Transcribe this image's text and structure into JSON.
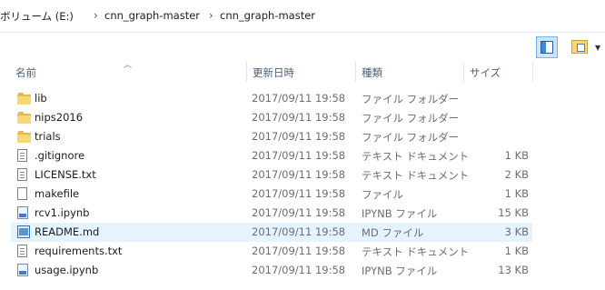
{
  "breadcrumb": {
    "drive": "ボリューム (E:)",
    "folder1": "cnn_graph-master",
    "folder2": "cnn_graph-master"
  },
  "columns": {
    "name": "名前",
    "date": "更新日時",
    "type": "種類",
    "size": "サイズ"
  },
  "files": [
    {
      "name": "lib",
      "date": "2017/09/11 19:58",
      "type": "ファイル フォルダー",
      "size": "",
      "icon": "folder-icon"
    },
    {
      "name": "nips2016",
      "date": "2017/09/11 19:58",
      "type": "ファイル フォルダー",
      "size": "",
      "icon": "folder-icon"
    },
    {
      "name": "trials",
      "date": "2017/09/11 19:58",
      "type": "ファイル フォルダー",
      "size": "",
      "icon": "folder-icon"
    },
    {
      "name": ".gitignore",
      "date": "2017/09/11 19:58",
      "type": "テキスト ドキュメント",
      "size": "1 KB",
      "icon": "text-file-icon"
    },
    {
      "name": "LICENSE.txt",
      "date": "2017/09/11 19:58",
      "type": "テキスト ドキュメント",
      "size": "2 KB",
      "icon": "text-file-icon"
    },
    {
      "name": "makefile",
      "date": "2017/09/11 19:58",
      "type": "ファイル",
      "size": "1 KB",
      "icon": "blank-file-icon"
    },
    {
      "name": "rcv1.ipynb",
      "date": "2017/09/11 19:58",
      "type": "IPYNB ファイル",
      "size": "15 KB",
      "icon": "notebook-file-icon"
    },
    {
      "name": "README.md",
      "date": "2017/09/11 19:58",
      "type": "MD ファイル",
      "size": "3 KB",
      "icon": "markdown-file-icon"
    },
    {
      "name": "requirements.txt",
      "date": "2017/09/11 19:58",
      "type": "テキスト ドキュメント",
      "size": "1 KB",
      "icon": "text-file-icon"
    },
    {
      "name": "usage.ipynb",
      "date": "2017/09/11 19:58",
      "type": "IPYNB ファイル",
      "size": "13 KB",
      "icon": "notebook-file-icon"
    }
  ],
  "colors": {
    "selected_row": "#e5f3ff",
    "header_text": "#4c607a",
    "folder": "#f8d775"
  }
}
